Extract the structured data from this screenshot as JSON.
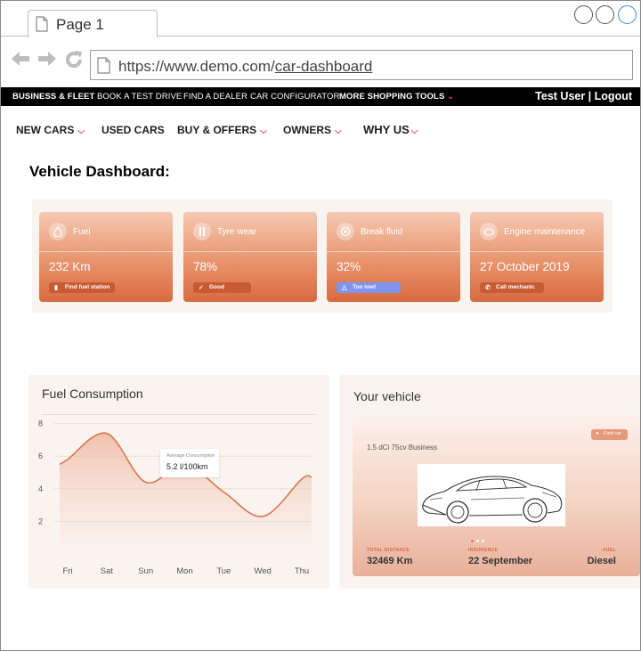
{
  "browser": {
    "tab_title": "Page 1",
    "url_base": "https://www.demo.com/",
    "url_path": "car-dashboard"
  },
  "topbar": {
    "items": [
      "BUSINESS & FLEET",
      "BOOK A TEST DRIVE",
      "FIND A DEALER",
      "CAR CONFIGURATOR",
      "MORE SHOPPING TOOLS"
    ],
    "user": "Test User | Logout"
  },
  "nav": {
    "items": [
      "NEW CARS",
      "USED CARS",
      "BUY & OFFERS",
      "OWNERS",
      "WHY US"
    ]
  },
  "page": {
    "title": "Vehicle Dashboard:"
  },
  "cards": [
    {
      "label": "Fuel",
      "value": "232 Km",
      "badge": "Find fuel station",
      "icon": "fuel-drop-icon"
    },
    {
      "label": "Tyre wear",
      "value": "78%",
      "badge": "Good",
      "icon": "tyre-icon"
    },
    {
      "label": "Break fluid",
      "value": "32%",
      "badge": "Too low!",
      "icon": "brake-disc-icon"
    },
    {
      "label": "Engine maintenance",
      "value": "27 October 2019",
      "badge": "Call mechanic",
      "icon": "engine-icon"
    }
  ],
  "fuel": {
    "title": "Fuel Consumption",
    "tooltip_label": "Average Consumption",
    "tooltip_value": "5.2 l/100km"
  },
  "chart_data": {
    "type": "area",
    "title": "Fuel Consumption",
    "categories": [
      "Fri",
      "Sat",
      "Sun",
      "Mon",
      "Tue",
      "Wed",
      "Thu"
    ],
    "y_ticks": [
      2,
      4,
      6,
      8
    ],
    "ylim": [
      0,
      9
    ],
    "series": [
      {
        "values": [
          5.8,
          7.4,
          4.4,
          5.5,
          3.8,
          2.3,
          4.6
        ]
      }
    ],
    "highlight": {
      "category": "Mon",
      "value": 5.5
    },
    "grid": true,
    "colors": {
      "line": "#d9774f",
      "fill": "#eeb097"
    }
  },
  "vehicle": {
    "title": "Your vehicle",
    "model": "1.5 dCi 75cv Business",
    "pill": "Find car",
    "stats": [
      {
        "label": "TOTAL DISTANCE",
        "value": "32469 Km"
      },
      {
        "label": "INSURANCE",
        "value": "22 September"
      },
      {
        "label": "FUEL",
        "value": "Diesel"
      }
    ]
  }
}
